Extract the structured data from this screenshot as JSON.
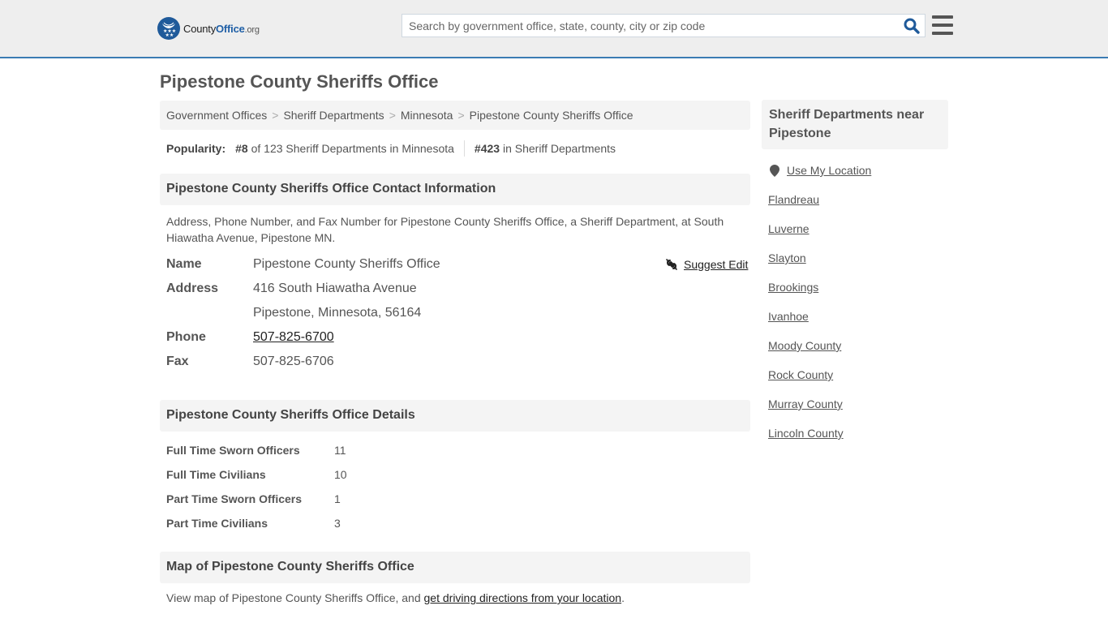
{
  "header": {
    "logo": {
      "part1": "County",
      "part2": "Office",
      "part3": ".org"
    },
    "search": {
      "placeholder": "Search by government office, state, county, city or zip code",
      "value": ""
    }
  },
  "page": {
    "title": "Pipestone County Sheriffs Office"
  },
  "breadcrumb": [
    "Government Offices",
    "Sheriff Departments",
    "Minnesota",
    "Pipestone County Sheriffs Office"
  ],
  "breadcrumb_separator": ">",
  "popularity": {
    "label": "Popularity:",
    "state_rank": "#8",
    "state_rank_text": " of 123 Sheriff Departments in Minnesota",
    "national_rank": "#423",
    "national_rank_text": " in Sheriff Departments"
  },
  "contact": {
    "heading": "Pipestone County Sheriffs Office Contact Information",
    "description": "Address, Phone Number, and Fax Number for Pipestone County Sheriffs Office, a Sheriff Department, at South Hiawatha Avenue, Pipestone MN.",
    "suggest_edit": "Suggest Edit",
    "rows": [
      {
        "label": "Name",
        "value": "Pipestone County Sheriffs Office"
      },
      {
        "label": "Address",
        "value": "416 South Hiawatha Avenue"
      },
      {
        "label": "",
        "value": "Pipestone, Minnesota, 56164"
      },
      {
        "label": "Phone",
        "value": "507-825-6700"
      },
      {
        "label": "Fax",
        "value": "507-825-6706"
      }
    ]
  },
  "details": {
    "heading": "Pipestone County Sheriffs Office Details",
    "rows": [
      {
        "label": "Full Time Sworn Officers",
        "value": "11"
      },
      {
        "label": "Full Time Civilians",
        "value": "10"
      },
      {
        "label": "Part Time Sworn Officers",
        "value": "1"
      },
      {
        "label": "Part Time Civilians",
        "value": "3"
      }
    ]
  },
  "map": {
    "heading": "Map of Pipestone County Sheriffs Office",
    "desc_prefix": "View map of Pipestone County Sheriffs Office, and ",
    "desc_link": "get driving directions from your location",
    "desc_suffix": "."
  },
  "sidebar": {
    "heading": "Sheriff Departments near Pipestone",
    "use_location": "Use My Location",
    "links": [
      "Flandreau",
      "Luverne",
      "Slayton",
      "Brookings",
      "Ivanhoe",
      "Moody County",
      "Rock County",
      "Murray County",
      "Lincoln County"
    ]
  },
  "colors": {
    "brand_blue": "#1f5a9a",
    "header_border": "#3b7bb3",
    "header_bg": "#eeeeee",
    "panel_bg": "#f4f4f4"
  }
}
